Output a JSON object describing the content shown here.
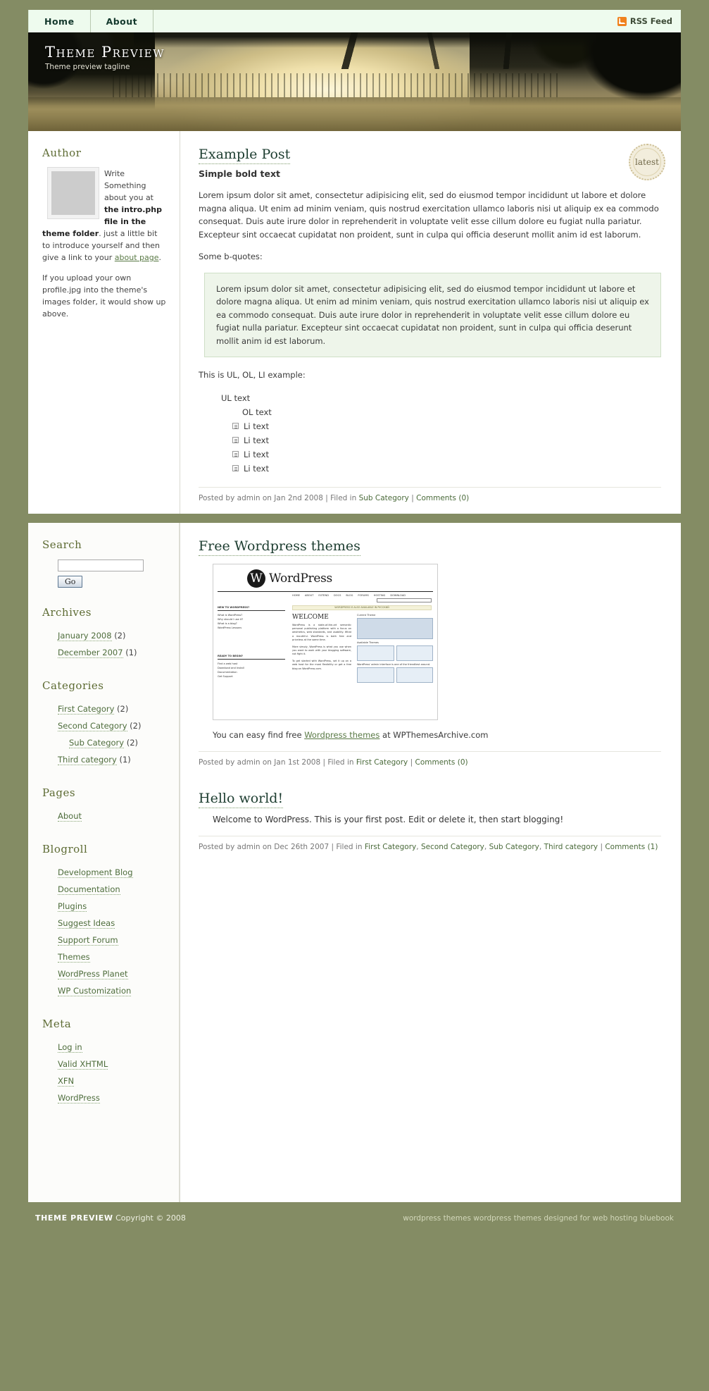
{
  "nav": {
    "tabs": [
      {
        "label": "Home"
      },
      {
        "label": "About"
      }
    ],
    "rss_label": "RSS Feed",
    "rss_icon": "rss-icon"
  },
  "header": {
    "title": "Theme Preview",
    "tagline": "Theme preview tagline"
  },
  "sidebar_author": {
    "heading": "Author",
    "avatar_name": "author-avatar",
    "para1_pre": "Write Something about you at ",
    "para1_b1": "the intro.php file in the theme folder",
    "para1_mid": ". just a little bit to introduce yourself and then give a link to your ",
    "para1_link": "about page",
    "para1_end": ".",
    "para2": "If you upload your own profile.jpg into the theme's images folder, it would show up above."
  },
  "badge": {
    "label": "latest"
  },
  "post1": {
    "title": "Example Post",
    "subtitle": "Simple bold text",
    "para1": "Lorem ipsum dolor sit amet, consectetur adipisicing elit, sed do eiusmod tempor incididunt ut labore et dolore magna aliqua. Ut enim ad minim veniam, quis nostrud exercitation ullamco laboris nisi ut aliquip ex ea commodo consequat. Duis aute irure dolor in reprehenderit in voluptate velit esse cillum dolore eu fugiat nulla pariatur. Excepteur sint occaecat cupidatat non proident, sunt in culpa qui officia deserunt mollit anim id est laborum.",
    "para2": "Some b-quotes:",
    "blockquote": "Lorem ipsum dolor sit amet, consectetur adipisicing elit, sed do eiusmod tempor incididunt ut labore et dolore magna aliqua. Ut enim ad minim veniam, quis nostrud exercitation ullamco laboris nisi ut aliquip ex ea commodo consequat. Duis aute irure dolor in reprehenderit in voluptate velit esse cillum dolore eu fugiat nulla pariatur. Excepteur sint occaecat cupidatat non proident, sunt in culpa qui officia deserunt mollit anim id est laborum.",
    "para3": "This is UL, OL, LI example:",
    "ul_text": "UL text",
    "ol_text": "OL text",
    "li_items": [
      "Li text",
      "Li text",
      "Li text",
      "Li text"
    ],
    "meta_prefix": "Posted by admin on Jan 2nd 2008 | Filed in ",
    "meta_cat": "Sub Category",
    "meta_sep": " | ",
    "meta_comments": "Comments (0)"
  },
  "search": {
    "heading": "Search",
    "value": "",
    "placeholder": "",
    "button": "Go"
  },
  "archives": {
    "heading": "Archives",
    "items": [
      {
        "label": "January 2008",
        "count": "(2)"
      },
      {
        "label": "December 2007",
        "count": "(1)"
      }
    ]
  },
  "categories": {
    "heading": "Categories",
    "items": [
      {
        "label": "First Category",
        "count": "(2)",
        "indent": false
      },
      {
        "label": "Second Category",
        "count": "(2)",
        "indent": false
      },
      {
        "label": "Sub Category",
        "count": "(2)",
        "indent": true
      },
      {
        "label": "Third category",
        "count": "(1)",
        "indent": false
      }
    ]
  },
  "pages": {
    "heading": "Pages",
    "items": [
      {
        "label": "About",
        "count": ""
      }
    ]
  },
  "blogroll": {
    "heading": "Blogroll",
    "items": [
      {
        "label": "Development Blog",
        "count": ""
      },
      {
        "label": "Documentation",
        "count": ""
      },
      {
        "label": "Plugins",
        "count": ""
      },
      {
        "label": "Suggest Ideas",
        "count": ""
      },
      {
        "label": "Support Forum",
        "count": ""
      },
      {
        "label": "Themes",
        "count": ""
      },
      {
        "label": "WordPress Planet",
        "count": ""
      },
      {
        "label": "WP Customization",
        "count": ""
      }
    ]
  },
  "meta_widget": {
    "heading": "Meta",
    "items": [
      {
        "label": "Log in",
        "count": ""
      },
      {
        "label": "Valid XHTML",
        "count": ""
      },
      {
        "label": "XFN",
        "count": ""
      },
      {
        "label": "WordPress",
        "count": ""
      }
    ]
  },
  "post2": {
    "title": "Free Wordpress themes",
    "caption_pre": "You can easy find free ",
    "caption_link": "Wordpress themes",
    "caption_post": " at WPThemesArchive.com",
    "meta_prefix": "Posted by admin on Jan 1st 2008 | Filed in ",
    "meta_cat": "First Category",
    "meta_sep": " | ",
    "meta_comments": "Comments (0)",
    "screenshot": {
      "brand": "WordPress",
      "nav": [
        "HOME",
        "ABOUT",
        "EXTEND",
        "DOCS",
        "BLOG",
        "FORUMS",
        "HOSTING",
        "DOWNLOAD"
      ],
      "search_button": "SEARCH »",
      "banner": "WORDPRESS IS ALSO AVAILABLE IN РУССКИЙ",
      "welcome": "WELCOME",
      "left_col_hd1": "NEW TO WORDPRESS?",
      "left_col_1": [
        "What is WordPress?",
        "Why should I use it?",
        "What is a blog?",
        "WordPress Lessons"
      ],
      "left_col_hd2": "READY TO BEGIN?",
      "left_col_2": [
        "Find a web host",
        "Download and Install",
        "Documentation",
        "Get Support"
      ],
      "body1": "WordPress is a state-of-the-art semantic personal publishing platform with a focus on aesthetics, web standards, and usability. What a mouthful. WordPress is both free and priceless at the same time.",
      "body2": "More simply, WordPress is what you use when you want to work with your blogging software, not fight it.",
      "body3": "To get started with WordPress, set it up on a web host for the most flexibility or get a free blog on WordPress.com.",
      "right_cap1": "Current Theme",
      "right_cap2": "Available Themes",
      "right_cap3": "WordPress' admin interface is one of the friendliest around."
    }
  },
  "post3": {
    "title": "Hello world!",
    "body": "Welcome to WordPress. This is your first post. Edit or delete it, then start blogging!",
    "meta_prefix": "Posted by admin on Dec 26th 2007 | Filed in ",
    "meta_cats": [
      "First Category",
      "Second Category",
      "Sub Category",
      "Third category"
    ],
    "meta_sep": " | ",
    "meta_comments": "Comments (1)"
  },
  "footer": {
    "title": "THEME PREVIEW",
    "copyright": "Copyright © 2008",
    "credit": "wordpress themes wordpress themes designed for web hosting bluebook"
  },
  "colors": {
    "page_bg": "#848c64",
    "nav_bg": "#eefbee",
    "heading": "#5d6b33",
    "link": "#4e6d3c",
    "quote_bg": "#eef5ea",
    "rss_orange": "#f0821e"
  }
}
